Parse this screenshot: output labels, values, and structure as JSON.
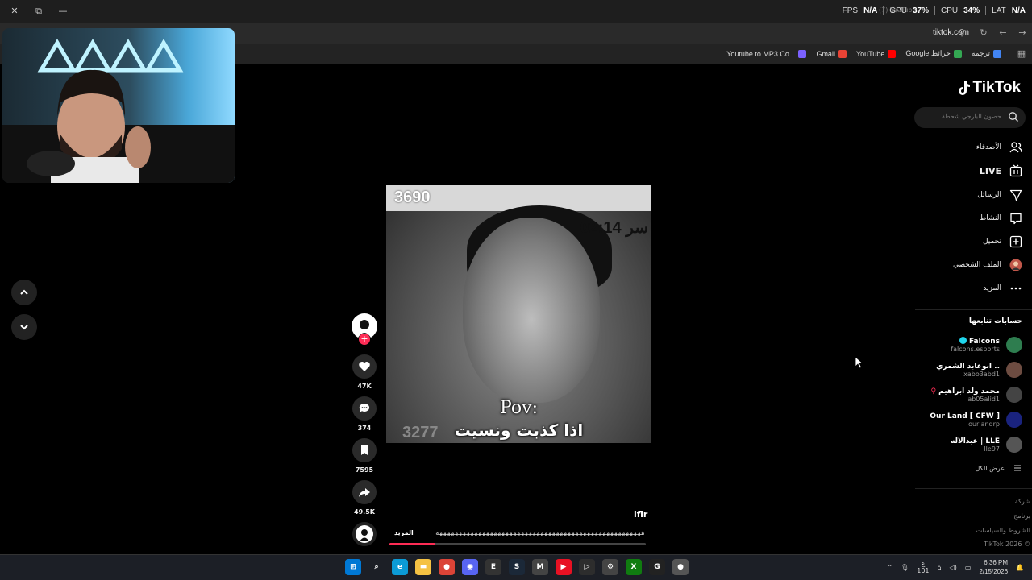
{
  "overlay": {
    "fps_label": "FPS",
    "fps_value": "N/A",
    "gpu_label": "GPU",
    "gpu_value": "37",
    "cpu_label": "CPU",
    "cpu_value": "34",
    "lat_label": "LAT",
    "lat_value": "N/A",
    "faint_tab": "(7) YouTube"
  },
  "browser": {
    "url": "tiktok.com",
    "bookmarks": [
      {
        "label": "ترجمة",
        "color": "#4285f4"
      },
      {
        "label": "Google خرائط",
        "color": "#34a853"
      },
      {
        "label": "YouTube",
        "color": "#ff0000"
      },
      {
        "label": "Gmail",
        "color": "#ea4335"
      },
      {
        "label": "Youtube to MP3 Co...",
        "color": "#7b61ff"
      }
    ]
  },
  "tiktok": {
    "logo_text": "TikTok",
    "search_placeholder": "حصون البارجي شحطة",
    "nav": [
      {
        "label": "الأصدقاء",
        "icon": "friends-icon"
      },
      {
        "label": "LIVE",
        "icon": "live-icon"
      },
      {
        "label": "الرسائل",
        "icon": "messages-icon"
      },
      {
        "label": "النشاط",
        "icon": "activity-icon"
      },
      {
        "label": "تحميل",
        "icon": "upload-icon"
      },
      {
        "label": "الملف الشخصي",
        "icon": "profile-icon"
      },
      {
        "label": "المزيد",
        "icon": "more-icon"
      }
    ],
    "following_title": "حسابات تتابعها",
    "following": [
      {
        "name": "Falcons",
        "handle": "falcons.esports",
        "verified": true,
        "avatar_color": "#2e7d4f"
      },
      {
        "name": "ابوعابد الشمري ..",
        "handle": "xabo3abd1",
        "verified": false,
        "avatar_color": "#6d4c41"
      },
      {
        "name": "محمد ولد ابراهيم",
        "handle": "ab05alid1",
        "verified": false,
        "avatar_color": "#444"
      },
      {
        "name": "Our Land [ CFW ]",
        "handle": "ourlandrp",
        "verified": false,
        "avatar_color": "#1a237e"
      },
      {
        "name": "عبدالاله | LLE",
        "handle": "lle97",
        "verified": false,
        "avatar_color": "#555"
      }
    ],
    "see_all": "عرض الكل",
    "footer": [
      "شركة",
      "برنامج",
      "الشروط والسياسات",
      "TikTok 2026 ©"
    ]
  },
  "video": {
    "overlay_count_top": "3690",
    "overlay_time": "02:14 سر",
    "overlay_count_bottom": "3277",
    "caption_line1": "Pov:",
    "caption_line2": "اذا كذبت ونسيت",
    "author": "iflr",
    "description": "هههههههههههههههههههههههههههههههههههههههههههههههههههههه",
    "more_label": "المزيد",
    "progress": 0.18,
    "likes": "47K",
    "comments": "374",
    "saves": "7595",
    "shares": "49.5K"
  },
  "taskbar": {
    "time": "6:36 PM",
    "date": "2/15/2026",
    "lang": "ع",
    "lang_sub": "101",
    "apps": [
      {
        "name": "start-icon",
        "color": "#0078d4",
        "glyph": "⊞"
      },
      {
        "name": "search-icon",
        "color": "transparent",
        "glyph": "⌕"
      },
      {
        "name": "edge-icon",
        "color": "#0c9bd6",
        "glyph": "e"
      },
      {
        "name": "file-explorer-icon",
        "color": "#f5c243",
        "glyph": "▬"
      },
      {
        "name": "chrome-icon",
        "color": "#db4437",
        "glyph": "●"
      },
      {
        "name": "discord-icon",
        "color": "#5865f2",
        "glyph": "◉"
      },
      {
        "name": "epic-games-icon",
        "color": "#333",
        "glyph": "E"
      },
      {
        "name": "steam-icon",
        "color": "#1b2838",
        "glyph": "S"
      },
      {
        "name": "app-icon",
        "color": "#444",
        "glyph": "M"
      },
      {
        "name": "media-player-icon",
        "color": "#e81123",
        "glyph": "▶"
      },
      {
        "name": "terminal-icon",
        "color": "#2d2d2d",
        "glyph": "▷"
      },
      {
        "name": "settings-icon",
        "color": "#444",
        "glyph": "⚙"
      },
      {
        "name": "xbox-icon",
        "color": "#107c10",
        "glyph": "X"
      },
      {
        "name": "app2-icon",
        "color": "#222",
        "glyph": "G"
      },
      {
        "name": "chrome-active-icon",
        "color": "#555",
        "glyph": "●"
      }
    ]
  }
}
